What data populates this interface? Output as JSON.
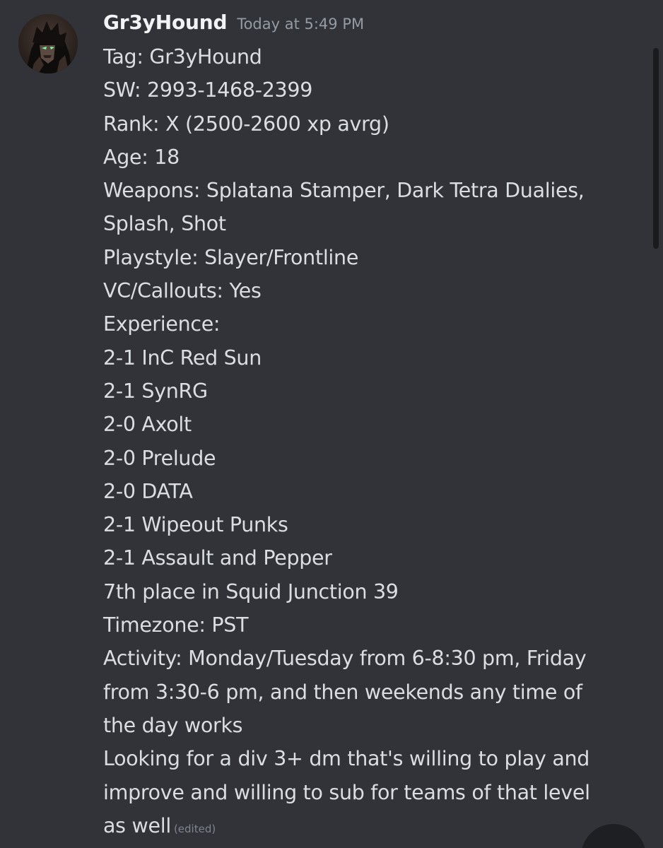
{
  "message": {
    "username": "Gr3yHound",
    "timestamp": "Today at 5:49 PM",
    "lines": [
      "Tag: Gr3yHound",
      "SW: 2993-1468-2399",
      "Rank: X (2500-2600 xp avrg)",
      "Age: 18",
      "Weapons: Splatana Stamper, Dark Tetra Dualies,",
      "Splash, Shot",
      "Playstyle: Slayer/Frontline",
      "VC/Callouts: Yes",
      "Experience:",
      "2-1 InC Red Sun",
      "2-1 SynRG",
      "2-0 Axolt",
      "2-0 Prelude",
      "2-0 DATA",
      "2-1 Wipeout Punks",
      "2-1 Assault and Pepper",
      "7th place in Squid Junction 39",
      "Timezone: PST",
      "Activity: Monday/Tuesday from 6-8:30 pm, Friday",
      "from 3:30-6 pm, and then weekends any time of",
      "the day works",
      "Looking for a div 3+ dm that's willing to play and",
      "improve and willing to sub for teams of that level",
      "as well"
    ],
    "edited_label": "(edited)"
  },
  "colors": {
    "background": "#313338",
    "username": "#f2f3f5",
    "timestamp": "#949ba4",
    "text": "#dbdee1",
    "edited": "#7f848e",
    "scrollbar_thumb": "#1a1b1e"
  },
  "icons": {
    "avatar": "user-avatar-dark-anime-character"
  }
}
